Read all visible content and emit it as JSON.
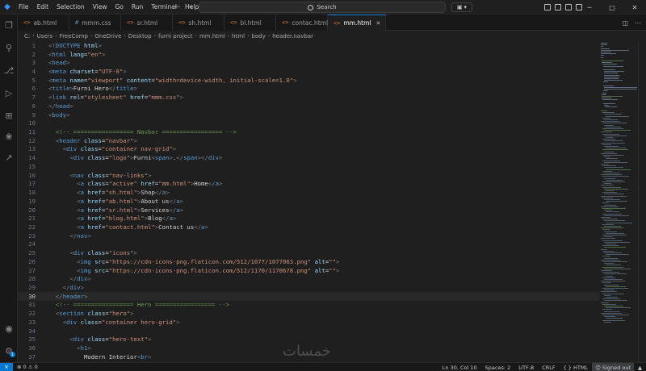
{
  "menu": [
    "File",
    "Edit",
    "Selection",
    "View",
    "Go",
    "Run",
    "Terminal",
    "Help"
  ],
  "search": {
    "label": "Search"
  },
  "tabs": [
    {
      "label": "ab.html",
      "type": "html",
      "active": false
    },
    {
      "label": "mmm.css",
      "type": "css",
      "active": false
    },
    {
      "label": "sr.html",
      "type": "html",
      "active": false
    },
    {
      "label": "sh.html",
      "type": "html",
      "active": false
    },
    {
      "label": "bl.html",
      "type": "html",
      "active": false
    },
    {
      "label": "contac.html",
      "type": "html",
      "active": false
    },
    {
      "label": "mm.html",
      "type": "html",
      "active": true
    }
  ],
  "breadcrumb": [
    "C:",
    "Users",
    "FreeComp",
    "OneDrive",
    "Desktop",
    "furni project",
    "mm.html",
    "html",
    "body",
    "header.navbar"
  ],
  "code": [
    {
      "n": "1",
      "t": [
        [
          "br",
          "<!"
        ],
        [
          "tg",
          "DOCTYPE"
        ],
        [
          "tx",
          " "
        ],
        [
          "at",
          "html"
        ],
        [
          "br",
          ">"
        ]
      ]
    },
    {
      "n": "2",
      "t": [
        [
          "br",
          "<"
        ],
        [
          "tg",
          "html"
        ],
        [
          "tx",
          " "
        ],
        [
          "at",
          "lang"
        ],
        [
          "tx",
          "="
        ],
        [
          "st",
          "\"en\""
        ],
        [
          "br",
          ">"
        ]
      ]
    },
    {
      "n": "3",
      "t": [
        [
          "br",
          "<"
        ],
        [
          "tg",
          "head"
        ],
        [
          "br",
          ">"
        ]
      ]
    },
    {
      "n": "4",
      "t": [
        [
          "br",
          "<"
        ],
        [
          "tg",
          "meta"
        ],
        [
          "tx",
          " "
        ],
        [
          "at",
          "charset"
        ],
        [
          "tx",
          "="
        ],
        [
          "st",
          "\"UTF-8\""
        ],
        [
          "br",
          ">"
        ]
      ]
    },
    {
      "n": "5",
      "t": [
        [
          "br",
          "<"
        ],
        [
          "tg",
          "meta"
        ],
        [
          "tx",
          " "
        ],
        [
          "at",
          "name"
        ],
        [
          "tx",
          "="
        ],
        [
          "st",
          "\"viewport\""
        ],
        [
          "tx",
          " "
        ],
        [
          "at",
          "content"
        ],
        [
          "tx",
          "="
        ],
        [
          "st",
          "\"width=device-width, initial-scale=1.0\""
        ],
        [
          "br",
          ">"
        ]
      ]
    },
    {
      "n": "6",
      "t": [
        [
          "br",
          "<"
        ],
        [
          "tg",
          "title"
        ],
        [
          "br",
          ">"
        ],
        [
          "tx",
          "Furni Hero"
        ],
        [
          "br",
          "</"
        ],
        [
          "tg",
          "title"
        ],
        [
          "br",
          ">"
        ]
      ]
    },
    {
      "n": "7",
      "t": [
        [
          "br",
          "<"
        ],
        [
          "tg",
          "link"
        ],
        [
          "tx",
          " "
        ],
        [
          "at",
          "rel"
        ],
        [
          "tx",
          "="
        ],
        [
          "st",
          "\"stylesheet\""
        ],
        [
          "tx",
          " "
        ],
        [
          "at",
          "href"
        ],
        [
          "tx",
          "="
        ],
        [
          "st",
          "\"mmm.css\""
        ],
        [
          "br",
          ">"
        ]
      ]
    },
    {
      "n": "8",
      "t": [
        [
          "br",
          "</"
        ],
        [
          "tg",
          "head"
        ],
        [
          "br",
          ">"
        ]
      ]
    },
    {
      "n": "9",
      "t": [
        [
          "br",
          "<"
        ],
        [
          "tg",
          "body"
        ],
        [
          "br",
          ">"
        ]
      ]
    },
    {
      "n": "10",
      "t": []
    },
    {
      "n": "11",
      "t": [
        [
          "tx",
          "  "
        ],
        [
          "cm",
          "<!-- ================= Navbar ================= -->"
        ]
      ]
    },
    {
      "n": "12",
      "t": [
        [
          "tx",
          "  "
        ],
        [
          "br",
          "<"
        ],
        [
          "tg",
          "header"
        ],
        [
          "tx",
          " "
        ],
        [
          "at",
          "class"
        ],
        [
          "tx",
          "="
        ],
        [
          "st",
          "\"navbar\""
        ],
        [
          "br",
          ">"
        ]
      ]
    },
    {
      "n": "13",
      "t": [
        [
          "tx",
          "    "
        ],
        [
          "br",
          "<"
        ],
        [
          "tg",
          "div"
        ],
        [
          "tx",
          " "
        ],
        [
          "at",
          "class"
        ],
        [
          "tx",
          "="
        ],
        [
          "st",
          "\"container nav-grid\""
        ],
        [
          "br",
          ">"
        ]
      ]
    },
    {
      "n": "14",
      "t": [
        [
          "tx",
          "      "
        ],
        [
          "br",
          "<"
        ],
        [
          "tg",
          "div"
        ],
        [
          "tx",
          " "
        ],
        [
          "at",
          "class"
        ],
        [
          "tx",
          "="
        ],
        [
          "st",
          "\"logo\""
        ],
        [
          "br",
          ">"
        ],
        [
          "tx",
          "Furni"
        ],
        [
          "br",
          "<"
        ],
        [
          "tg",
          "span"
        ],
        [
          "br",
          ">"
        ],
        [
          "tx",
          "."
        ],
        [
          "br",
          "</"
        ],
        [
          "tg",
          "span"
        ],
        [
          "br",
          "></"
        ],
        [
          "tg",
          "div"
        ],
        [
          "br",
          ">"
        ]
      ]
    },
    {
      "n": "15",
      "t": []
    },
    {
      "n": "16",
      "t": [
        [
          "tx",
          "      "
        ],
        [
          "br",
          "<"
        ],
        [
          "tg",
          "nav"
        ],
        [
          "tx",
          " "
        ],
        [
          "at",
          "class"
        ],
        [
          "tx",
          "="
        ],
        [
          "st",
          "\"nav-links\""
        ],
        [
          "br",
          ">"
        ]
      ]
    },
    {
      "n": "17",
      "t": [
        [
          "tx",
          "        "
        ],
        [
          "br",
          "<"
        ],
        [
          "tg",
          "a"
        ],
        [
          "tx",
          " "
        ],
        [
          "at",
          "class"
        ],
        [
          "tx",
          "="
        ],
        [
          "st",
          "\"active\""
        ],
        [
          "tx",
          " "
        ],
        [
          "at",
          "href"
        ],
        [
          "tx",
          "="
        ],
        [
          "st",
          "\"mm.html\""
        ],
        [
          "br",
          ">"
        ],
        [
          "tx",
          "Home"
        ],
        [
          "br",
          "</"
        ],
        [
          "tg",
          "a"
        ],
        [
          "br",
          ">"
        ]
      ]
    },
    {
      "n": "18",
      "t": [
        [
          "tx",
          "        "
        ],
        [
          "br",
          "<"
        ],
        [
          "tg",
          "a"
        ],
        [
          "tx",
          " "
        ],
        [
          "at",
          "href"
        ],
        [
          "tx",
          "="
        ],
        [
          "st",
          "\"sh.html\""
        ],
        [
          "br",
          ">"
        ],
        [
          "tx",
          "Shop"
        ],
        [
          "br",
          "</"
        ],
        [
          "tg",
          "a"
        ],
        [
          "br",
          ">"
        ]
      ]
    },
    {
      "n": "19",
      "t": [
        [
          "tx",
          "        "
        ],
        [
          "br",
          "<"
        ],
        [
          "tg",
          "a"
        ],
        [
          "tx",
          " "
        ],
        [
          "at",
          "href"
        ],
        [
          "tx",
          "="
        ],
        [
          "st",
          "\"ab.html\""
        ],
        [
          "br",
          ">"
        ],
        [
          "tx",
          "About us"
        ],
        [
          "br",
          "</"
        ],
        [
          "tg",
          "a"
        ],
        [
          "br",
          ">"
        ]
      ]
    },
    {
      "n": "20",
      "t": [
        [
          "tx",
          "        "
        ],
        [
          "br",
          "<"
        ],
        [
          "tg",
          "a"
        ],
        [
          "tx",
          " "
        ],
        [
          "at",
          "href"
        ],
        [
          "tx",
          "="
        ],
        [
          "st",
          "\"sr.html\""
        ],
        [
          "br",
          ">"
        ],
        [
          "tx",
          "Services"
        ],
        [
          "br",
          "</"
        ],
        [
          "tg",
          "a"
        ],
        [
          "br",
          ">"
        ]
      ]
    },
    {
      "n": "21",
      "t": [
        [
          "tx",
          "        "
        ],
        [
          "br",
          "<"
        ],
        [
          "tg",
          "a"
        ],
        [
          "tx",
          " "
        ],
        [
          "at",
          "href"
        ],
        [
          "tx",
          "="
        ],
        [
          "st",
          "\"blog.html\""
        ],
        [
          "br",
          ">"
        ],
        [
          "tx",
          "Blog"
        ],
        [
          "br",
          "</"
        ],
        [
          "tg",
          "a"
        ],
        [
          "br",
          ">"
        ]
      ]
    },
    {
      "n": "22",
      "t": [
        [
          "tx",
          "        "
        ],
        [
          "br",
          "<"
        ],
        [
          "tg",
          "a"
        ],
        [
          "tx",
          " "
        ],
        [
          "at",
          "href"
        ],
        [
          "tx",
          "="
        ],
        [
          "st",
          "\"contact.html\""
        ],
        [
          "br",
          ">"
        ],
        [
          "tx",
          "Contact us"
        ],
        [
          "br",
          "</"
        ],
        [
          "tg",
          "a"
        ],
        [
          "br",
          ">"
        ]
      ]
    },
    {
      "n": "23",
      "t": [
        [
          "tx",
          "      "
        ],
        [
          "br",
          "</"
        ],
        [
          "tg",
          "nav"
        ],
        [
          "br",
          ">"
        ]
      ]
    },
    {
      "n": "24",
      "t": []
    },
    {
      "n": "25",
      "t": [
        [
          "tx",
          "      "
        ],
        [
          "br",
          "<"
        ],
        [
          "tg",
          "div"
        ],
        [
          "tx",
          " "
        ],
        [
          "at",
          "class"
        ],
        [
          "tx",
          "="
        ],
        [
          "st",
          "\"icons\""
        ],
        [
          "br",
          ">"
        ]
      ]
    },
    {
      "n": "26",
      "t": [
        [
          "tx",
          "        "
        ],
        [
          "br",
          "<"
        ],
        [
          "tg",
          "img"
        ],
        [
          "tx",
          " "
        ],
        [
          "at",
          "src"
        ],
        [
          "tx",
          "="
        ],
        [
          "st",
          "\"https://cdn-icons-png.flaticon.com/512/1077/1077063.png\""
        ],
        [
          "tx",
          " "
        ],
        [
          "at",
          "alt"
        ],
        [
          "tx",
          "="
        ],
        [
          "st",
          "\"\""
        ],
        [
          "br",
          ">"
        ]
      ]
    },
    {
      "n": "27",
      "t": [
        [
          "tx",
          "        "
        ],
        [
          "br",
          "<"
        ],
        [
          "tg",
          "img"
        ],
        [
          "tx",
          " "
        ],
        [
          "at",
          "src"
        ],
        [
          "tx",
          "="
        ],
        [
          "st",
          "\"https://cdn-icons-png.flaticon.com/512/1170/1170678.png\""
        ],
        [
          "tx",
          " "
        ],
        [
          "at",
          "alt"
        ],
        [
          "tx",
          "="
        ],
        [
          "st",
          "\"\""
        ],
        [
          "br",
          ">"
        ]
      ]
    },
    {
      "n": "28",
      "t": [
        [
          "tx",
          "      "
        ],
        [
          "br",
          "</"
        ],
        [
          "tg",
          "div"
        ],
        [
          "br",
          ">"
        ]
      ]
    },
    {
      "n": "29",
      "t": [
        [
          "tx",
          "    "
        ],
        [
          "br",
          "</"
        ],
        [
          "tg",
          "div"
        ],
        [
          "br",
          ">"
        ]
      ]
    },
    {
      "n": "30",
      "t": [
        [
          "tx",
          "  "
        ],
        [
          "br",
          "</"
        ],
        [
          "tg",
          "header"
        ],
        [
          "br",
          ">"
        ]
      ],
      "current": true
    },
    {
      "n": "31",
      "t": [
        [
          "tx",
          "  "
        ],
        [
          "cm",
          "<!-- ================= Hero ================= -->"
        ]
      ]
    },
    {
      "n": "32",
      "t": [
        [
          "tx",
          "  "
        ],
        [
          "br",
          "<"
        ],
        [
          "tg",
          "section"
        ],
        [
          "tx",
          " "
        ],
        [
          "at",
          "class"
        ],
        [
          "tx",
          "="
        ],
        [
          "st",
          "\"hero\""
        ],
        [
          "br",
          ">"
        ]
      ]
    },
    {
      "n": "33",
      "t": [
        [
          "tx",
          "    "
        ],
        [
          "br",
          "<"
        ],
        [
          "tg",
          "div"
        ],
        [
          "tx",
          " "
        ],
        [
          "at",
          "class"
        ],
        [
          "tx",
          "="
        ],
        [
          "st",
          "\"container hero-grid\""
        ],
        [
          "br",
          ">"
        ]
      ]
    },
    {
      "n": "34",
      "t": []
    },
    {
      "n": "35",
      "t": [
        [
          "tx",
          "      "
        ],
        [
          "br",
          "<"
        ],
        [
          "tg",
          "div"
        ],
        [
          "tx",
          " "
        ],
        [
          "at",
          "class"
        ],
        [
          "tx",
          "="
        ],
        [
          "st",
          "\"hero-text\""
        ],
        [
          "br",
          ">"
        ]
      ]
    },
    {
      "n": "36",
      "t": [
        [
          "tx",
          "        "
        ],
        [
          "br",
          "<"
        ],
        [
          "tg",
          "h1"
        ],
        [
          "br",
          ">"
        ]
      ]
    },
    {
      "n": "37",
      "t": [
        [
          "tx",
          "          "
        ],
        [
          "tx",
          "Modern Interior"
        ],
        [
          "br",
          "<"
        ],
        [
          "tg",
          "br"
        ],
        [
          "br",
          ">"
        ]
      ]
    }
  ],
  "watermark": "خمسات",
  "status": {
    "errors": "0",
    "warnings": "0",
    "position": "Ln 30, Col 10",
    "spaces": "Spaces: 2",
    "encoding": "UTF-8",
    "eol": "CRLF",
    "language": "HTML",
    "account": "Signed out"
  },
  "colors": {
    "accent": "#0078d4",
    "tag": "#569cd6",
    "attr": "#9cdcfe",
    "string": "#ce9178",
    "comment": "#6a9955"
  }
}
